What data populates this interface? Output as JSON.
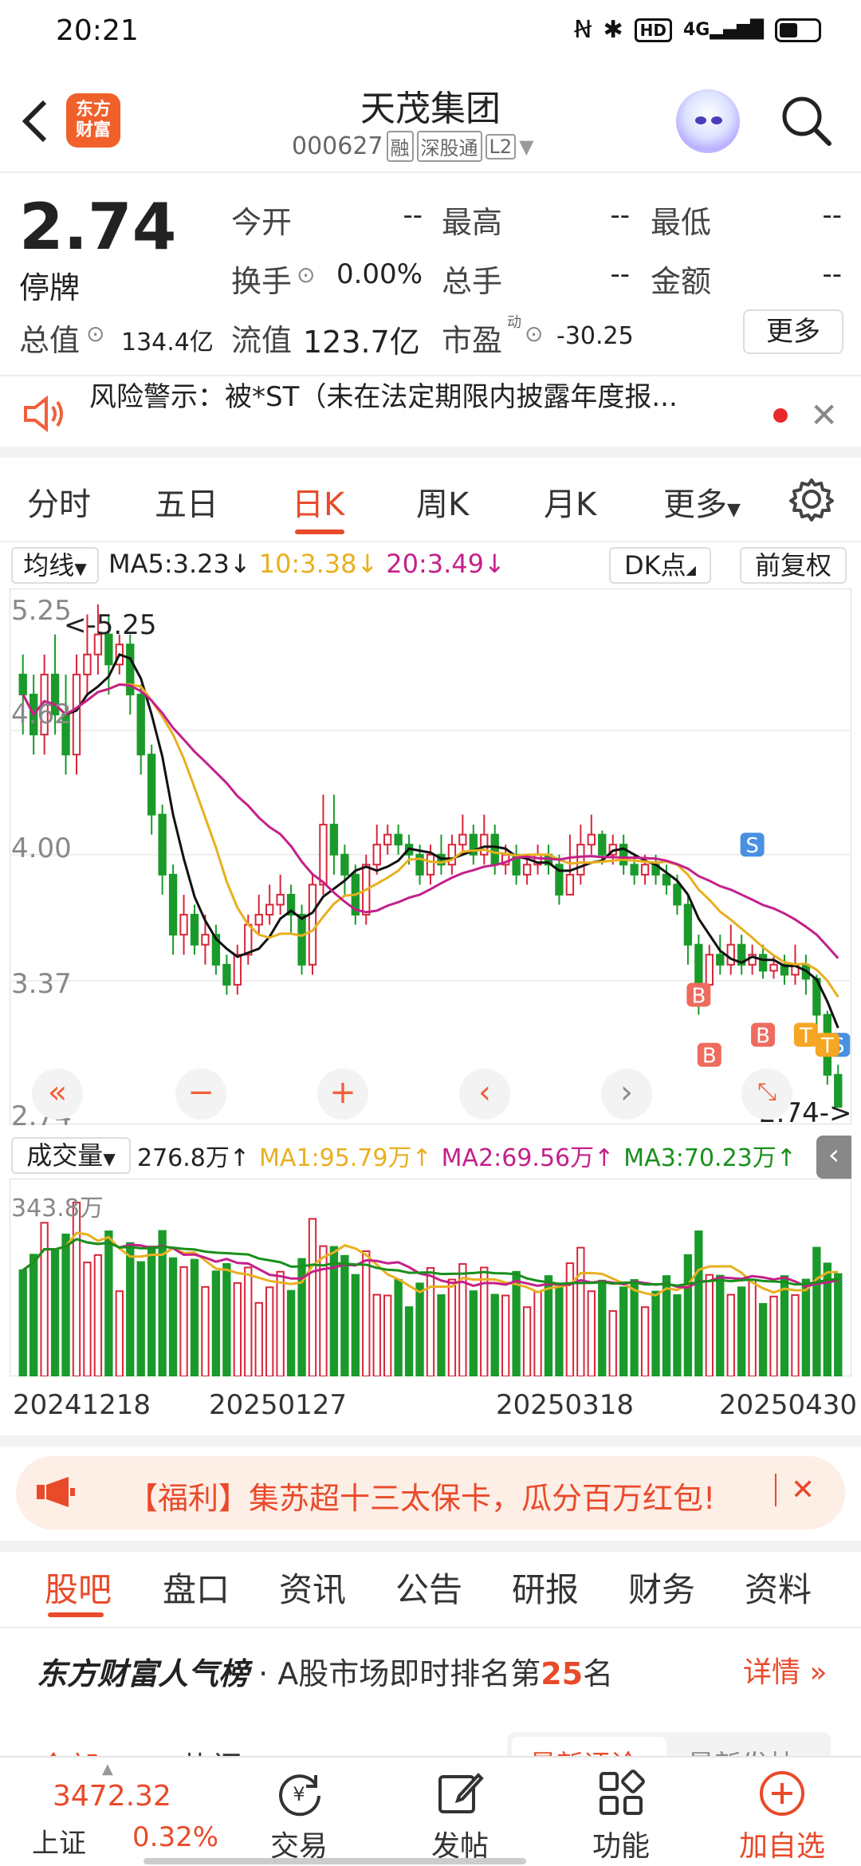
{
  "status": {
    "time": "20:21",
    "network": "4G"
  },
  "header": {
    "title": "天茂集团",
    "code": "000627",
    "tags": [
      "融",
      "深股通",
      "L2"
    ],
    "logo": "东方财富"
  },
  "quote": {
    "price": "2.74",
    "state": "停牌",
    "open_label": "今开",
    "open": "--",
    "high_label": "最高",
    "high": "--",
    "low_label": "最低",
    "low": "--",
    "turnover_label": "换手",
    "turnover": "0.00%",
    "volume_label": "总手",
    "volume": "--",
    "amount_label": "金额",
    "amount": "--",
    "mcap_label": "总值",
    "mcap": "134.4亿",
    "float_label": "流值",
    "float": "123.7亿",
    "pe_label": "市盈",
    "pe_sup": "动",
    "pe": "-30.25",
    "more": "更多"
  },
  "risk": {
    "text": "风险警示：被*ST（未在法定期限内披露年度报..."
  },
  "tabs": [
    "分时",
    "五日",
    "日K",
    "周K",
    "月K",
    "更多"
  ],
  "ma": {
    "mode": "均线",
    "ma5": "MA5:3.23",
    "ma10": "10:3.38",
    "ma20": "20:3.49",
    "dk": "DK点",
    "adjust": "前复权",
    "color_ma5": "#111111",
    "color_ma10": "#e8b020",
    "color_ma20": "#c4208a"
  },
  "kchart_labels": {
    "y_top": "5.25",
    "y_2": "4.62",
    "y_3": "4.00",
    "y_4": "3.37",
    "y_bottom": "2.74",
    "max_tag": "<-5.25",
    "last_tag": "2.74->"
  },
  "volume": {
    "mode": "成交量",
    "value": "276.8万",
    "ma1": "MA1:95.79万",
    "ma2": "MA2:69.56万",
    "ma3": "MA3:70.23万",
    "max": "343.8万"
  },
  "xaxis": [
    "20241218",
    "20250127",
    "20250318",
    "20250430"
  ],
  "banner": {
    "text": "【福利】集苏超十三太保卡，瓜分百万红包!"
  },
  "subtabs": [
    "股吧",
    "盘口",
    "资讯",
    "公告",
    "研报",
    "财务",
    "资料"
  ],
  "rank": {
    "brand": "东方财富人气榜",
    "text_a": " · A股市场即时排名第",
    "num": "25",
    "text_b": "名",
    "detail": "详情"
  },
  "peek": {
    "a": "全部",
    "b": "热门",
    "c": "最新评论",
    "d": "最新发帖"
  },
  "bottom": {
    "index_value": "3472.32",
    "index_name": "上证",
    "index_change": "0.32%",
    "trade": "交易",
    "post": "发帖",
    "func": "功能",
    "watch": "加自选"
  },
  "chart_data": {
    "type": "candlestick",
    "y_range": [
      2.74,
      5.25
    ],
    "x_labels": [
      "20241218",
      "20250127",
      "20250318",
      "20250430"
    ],
    "ma5_last": 3.23,
    "ma10_last": 3.38,
    "ma20_last": 3.49,
    "last_close": 2.74,
    "max": 5.25,
    "candles": [
      [
        4.9,
        4.8,
        5.0,
        4.6
      ],
      [
        4.8,
        4.6,
        4.9,
        4.5
      ],
      [
        4.6,
        4.9,
        5.0,
        4.5
      ],
      [
        4.9,
        4.7,
        5.1,
        4.6
      ],
      [
        4.7,
        4.5,
        4.9,
        4.4
      ],
      [
        4.5,
        4.9,
        5.0,
        4.4
      ],
      [
        4.9,
        5.0,
        5.2,
        4.8
      ],
      [
        5.0,
        5.1,
        5.25,
        4.9
      ],
      [
        5.1,
        4.95,
        5.2,
        4.8
      ],
      [
        4.95,
        5.05,
        5.1,
        4.9
      ],
      [
        5.05,
        4.8,
        5.1,
        4.7
      ],
      [
        4.8,
        4.5,
        4.85,
        4.4
      ],
      [
        4.5,
        4.2,
        4.55,
        4.1
      ],
      [
        4.2,
        3.9,
        4.25,
        3.8
      ],
      [
        3.9,
        3.6,
        3.95,
        3.5
      ],
      [
        3.6,
        3.7,
        3.8,
        3.5
      ],
      [
        3.7,
        3.55,
        3.75,
        3.5
      ],
      [
        3.55,
        3.6,
        3.7,
        3.45
      ],
      [
        3.6,
        3.45,
        3.65,
        3.4
      ],
      [
        3.45,
        3.35,
        3.5,
        3.3
      ],
      [
        3.35,
        3.5,
        3.55,
        3.3
      ],
      [
        3.5,
        3.65,
        3.7,
        3.45
      ],
      [
        3.65,
        3.7,
        3.8,
        3.6
      ],
      [
        3.7,
        3.75,
        3.85,
        3.65
      ],
      [
        3.75,
        3.8,
        3.9,
        3.7
      ],
      [
        3.8,
        3.7,
        3.85,
        3.6
      ],
      [
        3.7,
        3.45,
        3.75,
        3.4
      ],
      [
        3.45,
        3.85,
        3.9,
        3.4
      ],
      [
        3.85,
        4.15,
        4.3,
        3.8
      ],
      [
        4.15,
        4.0,
        4.3,
        3.9
      ],
      [
        4.0,
        3.9,
        4.05,
        3.8
      ],
      [
        3.9,
        3.7,
        3.95,
        3.65
      ],
      [
        3.7,
        3.95,
        4.0,
        3.65
      ],
      [
        3.95,
        4.05,
        4.15,
        3.9
      ],
      [
        4.05,
        4.1,
        4.15,
        4.0
      ],
      [
        4.1,
        4.05,
        4.15,
        4.0
      ],
      [
        4.05,
        4.0,
        4.1,
        3.95
      ],
      [
        4.0,
        3.9,
        4.05,
        3.85
      ],
      [
        3.9,
        4.0,
        4.05,
        3.85
      ],
      [
        4.0,
        3.95,
        4.1,
        3.9
      ],
      [
        3.95,
        4.05,
        4.1,
        3.9
      ],
      [
        4.05,
        4.1,
        4.2,
        4.0
      ],
      [
        4.1,
        4.0,
        4.15,
        3.95
      ],
      [
        4.0,
        4.1,
        4.2,
        3.95
      ],
      [
        4.1,
        3.95,
        4.15,
        3.9
      ],
      [
        3.95,
        4.0,
        4.05,
        3.9
      ],
      [
        4.0,
        3.9,
        4.05,
        3.85
      ],
      [
        3.9,
        3.95,
        4.0,
        3.85
      ],
      [
        3.95,
        4.0,
        4.05,
        3.9
      ],
      [
        4.0,
        3.95,
        4.05,
        3.9
      ],
      [
        3.95,
        3.8,
        4.0,
        3.75
      ],
      [
        3.8,
        3.9,
        4.1,
        3.8
      ],
      [
        3.9,
        4.05,
        4.15,
        3.85
      ],
      [
        4.05,
        4.1,
        4.2,
        4.0
      ],
      [
        4.1,
        4.0,
        4.12,
        3.95
      ],
      [
        4.0,
        4.05,
        4.1,
        3.95
      ],
      [
        4.05,
        3.95,
        4.1,
        3.9
      ],
      [
        3.95,
        3.9,
        4.0,
        3.85
      ],
      [
        3.9,
        3.95,
        4.0,
        3.85
      ],
      [
        3.95,
        3.9,
        4.0,
        3.85
      ],
      [
        3.9,
        3.85,
        3.95,
        3.8
      ],
      [
        3.85,
        3.75,
        3.9,
        3.7
      ],
      [
        3.75,
        3.55,
        3.8,
        3.45
      ],
      [
        3.55,
        3.35,
        3.6,
        3.2
      ],
      [
        3.35,
        3.5,
        3.55,
        3.25
      ],
      [
        3.5,
        3.45,
        3.6,
        3.4
      ],
      [
        3.45,
        3.55,
        3.65,
        3.4
      ],
      [
        3.55,
        3.45,
        3.6,
        3.4
      ],
      [
        3.45,
        3.5,
        3.55,
        3.4
      ],
      [
        3.5,
        3.42,
        3.55,
        3.38
      ],
      [
        3.42,
        3.45,
        3.5,
        3.38
      ],
      [
        3.45,
        3.4,
        3.5,
        3.35
      ],
      [
        3.4,
        3.45,
        3.55,
        3.35
      ],
      [
        3.45,
        3.38,
        3.5,
        3.3
      ],
      [
        3.38,
        3.2,
        3.4,
        3.1
      ],
      [
        3.2,
        2.9,
        3.22,
        2.85
      ],
      [
        2.9,
        2.74,
        2.95,
        2.74
      ]
    ]
  }
}
